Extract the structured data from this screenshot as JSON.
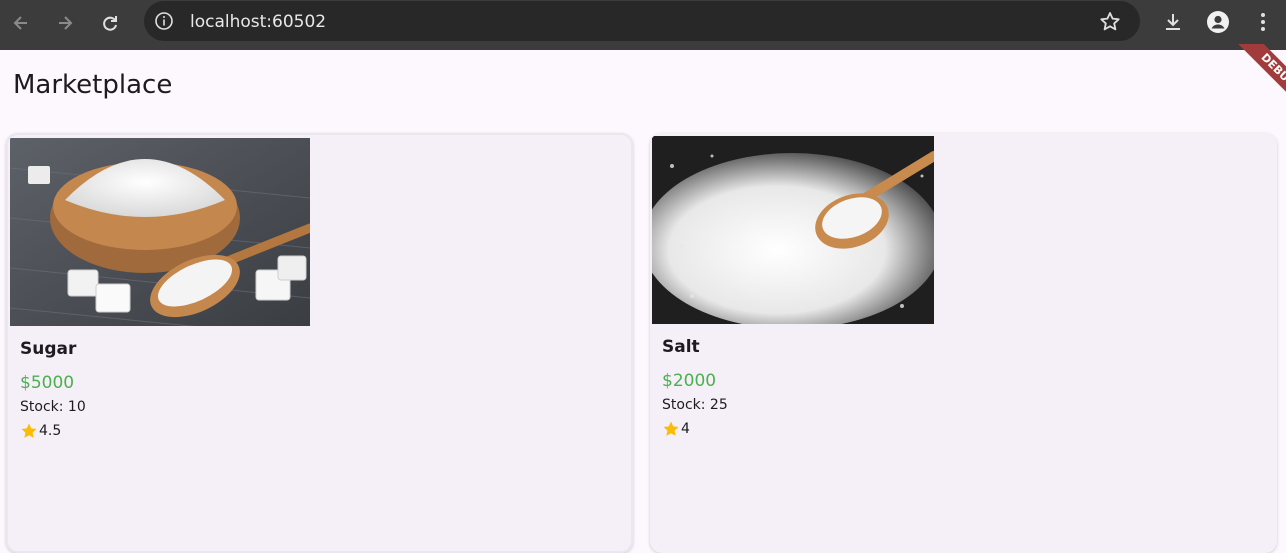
{
  "browser": {
    "url": "localhost:60502",
    "icons": [
      "back-arrow-icon",
      "forward-arrow-icon",
      "reload-icon",
      "site-info-icon",
      "bookmark-star-icon",
      "download-icon",
      "profile-icon",
      "menu-dots-icon"
    ]
  },
  "app": {
    "title": "Marketplace",
    "debug_banner": "DEBUG"
  },
  "products": [
    {
      "name": "Sugar",
      "price": "$5000",
      "stock": "Stock: 10",
      "rating": "4.5",
      "image": "sugar-bowl-photo"
    },
    {
      "name": "Salt",
      "price": "$2000",
      "stock": "Stock: 25",
      "rating": "4",
      "image": "salt-spoon-photo"
    }
  ],
  "colors": {
    "background": "#fdf7fe",
    "card": "#f5f0f7",
    "price": "#4caf50",
    "star": "#fbbc05",
    "debug": "#a23b3b",
    "chrome": "#3c3c3c"
  }
}
